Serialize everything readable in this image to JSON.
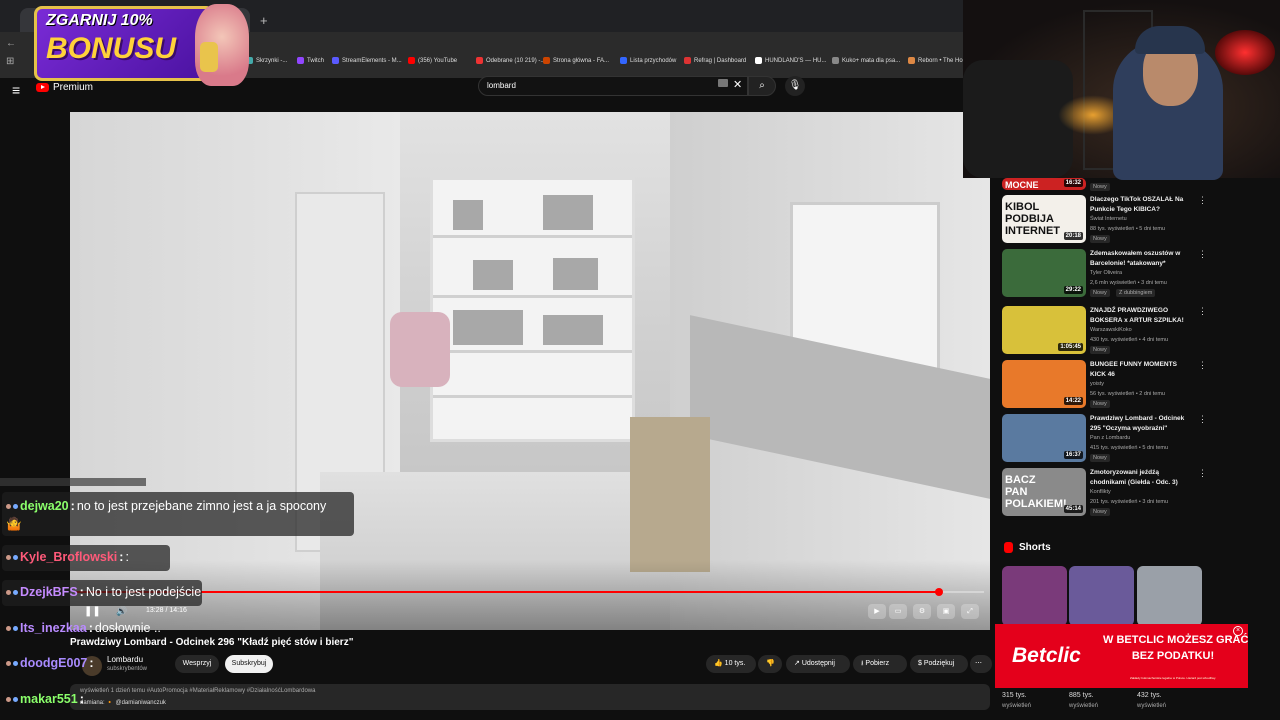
{
  "browser": {
    "tab_close": "×",
    "newtab": "+",
    "bookmarks": [
      "Skrzynki -...",
      "Twitch",
      "StreamElements - M...",
      "(356) YouTube",
      "Odebrane (10 219) -...",
      "Strona główna - FA...",
      "Lista przychodów",
      "Refrag | Dashboard",
      "HUNDLAND'S — HU...",
      "Kuko+ mata dla psa...",
      "Reborn • The Ho"
    ]
  },
  "yt": {
    "menu_icon": "≡",
    "logo_text": "Premium",
    "search_value": "lombard",
    "clear": "✕",
    "search_btn": "⌕",
    "mic": "🎙"
  },
  "player": {
    "time": "13:28 / 14:16",
    "progress": 0.95,
    "play_icon": "❚❚",
    "vol_icon": "🔊",
    "ctrl_icons": [
      "▶",
      "▭",
      "⚙",
      "▣",
      "⤢"
    ]
  },
  "video": {
    "title": "Prawdziwy Lombard - Odcinek 296 \"Kładź pięć stów i bierz\"",
    "channel": "Lombardu",
    "channel_subs": "subskrybentów",
    "support": "Wesprzyj",
    "subscribe": "Subskrybuj",
    "likes": "10 tys.",
    "share": "Udostępnij",
    "download": "Pobierz",
    "thanks": "Podziękuj",
    "more": "⋯",
    "desc_views": "wyświetleń  1 dzień temu",
    "desc_tags": "#AutoPromocja #MateriałReklamowy #DziałalnośćLombardowa",
    "desc_line2": "damiana:  🔸 @damianiwanczuk"
  },
  "chat": [
    {
      "user": "dejwa20",
      "msg": "no to jest przejebane zimno jest a ja spocony",
      "color": "#8bff6b",
      "line2": "🤷"
    },
    {
      "user": "Kyle_Broflowski",
      "msg": ":",
      "color": "#ff5a7a"
    },
    {
      "user": "DzejkBFS",
      "msg": "No i to jest podejście",
      "color": "#c58bff"
    },
    {
      "user": "Its_inezkaa",
      "msg": "dosłownie ..",
      "color": "#b98bff"
    },
    {
      "user": "doodgE007",
      "msg": "",
      "color": "#a98bff"
    },
    {
      "user": "makar551",
      "msg": "",
      "color": "#8bff6b"
    }
  ],
  "sidebar": {
    "items": [
      {
        "title": "",
        "meta1": "",
        "meta2": "Nowy",
        "dur": "16:32",
        "thumb": "#c22",
        "thumb_text": "MOCNE"
      },
      {
        "title": "Dlaczego TikTok OSZALAŁ Na Punkcie Tego KIBICA?",
        "meta1": "Świat Internetu",
        "meta2": "88 tys. wyświetleń • 5 dni temu",
        "tag": "Nowy",
        "dur": "20:18",
        "thumb": "#f3f0ea",
        "thumb_text": "KIBOL PODBIJA INTERNET"
      },
      {
        "title": "Zdemaskowałem oszustów w Barcelonie! *atakowany*",
        "meta1": "Tyler Oliveira",
        "meta2": "2,6 mln wyświetleń • 3 dni temu",
        "tag": "Nowy",
        "tag2": "Z dubbingiem",
        "dur": "29:22",
        "thumb": "#3b6b3b"
      },
      {
        "title": "ZNAJDŹ PRAWDZIWEGO BOKSERA x ARTUR SZPILKA!",
        "meta1": "WarszawskiKoko",
        "meta2": "430 tys. wyświetleń • 4 dni temu",
        "tag": "Nowy",
        "dur": "1:05:45",
        "thumb": "#d8c13a"
      },
      {
        "title": "BUNGEE FUNNY MOMENTS KICK 46",
        "meta1": "yoisty",
        "meta2": "56 tys. wyświetleń • 2 dni temu",
        "tag": "Nowy",
        "dur": "14:22",
        "thumb": "#e8792a"
      },
      {
        "title": "Prawdziwy Lombard - Odcinek 295 \"Oczyma wyobraźni\"",
        "meta1": "Pan z Lombardu",
        "meta2": "415 tys. wyświetleń • 5 dni temu",
        "tag": "Nowy",
        "dur": "16:37",
        "thumb": "#5a7aa0"
      },
      {
        "title": "Zmotoryzowani jeźdźą chodnikami (Giełda - Odc. 3)",
        "meta1": "Konflikty",
        "meta2": "201 tys. wyświetleń • 3 dni temu",
        "tag": "Nowy",
        "dur": "45:14",
        "thumb": "#8a8a8a",
        "thumb_text": "BACZ PAN POLAKIEM!"
      }
    ],
    "shorts_title": "Shorts",
    "shorts": [
      {
        "views": "315 tys.",
        "sub": "wyświetleń",
        "color": "#7a3a7a"
      },
      {
        "views": "885 tys.",
        "sub": "wyświetleń",
        "color": "#6a5a9a"
      },
      {
        "views": "432 tys.",
        "sub": "wyświetleń",
        "color": "#9aa0a8"
      }
    ]
  },
  "promo": {
    "line1": "ZGARNIJ 10%",
    "line2": "BONUSU"
  },
  "betclic": {
    "logo": "Betclic",
    "line1": "W BETCLIC MOŻESZ GRAĆ",
    "line2": "BEZ PODATKU!",
    "small": "Zakłady bukmacherskie legalne w Polsce. Hazard jest szkodliwy.",
    "close": "×"
  }
}
